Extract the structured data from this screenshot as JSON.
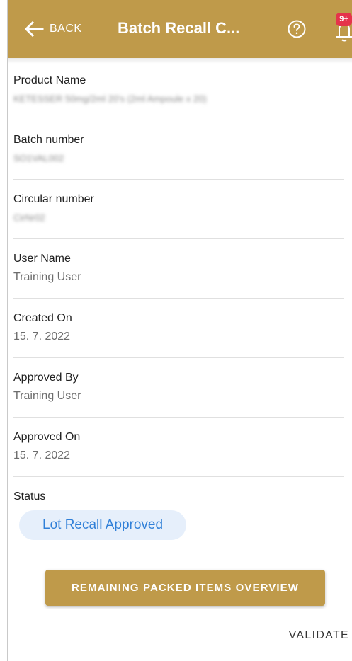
{
  "appbar": {
    "back_label": "BACK",
    "title": "Batch Recall C...",
    "badge": "9+",
    "color": "#bf9a4a"
  },
  "fields": [
    {
      "label": "Product Name",
      "value": "KETESSER 50mg/2ml 20's (2ml Ampoule x 20)"
    },
    {
      "label": "Batch number",
      "value": "SO1VAL002"
    },
    {
      "label": "Circular number",
      "value": "CirNr02"
    },
    {
      "label": "User Name",
      "value": "Training User"
    },
    {
      "label": "Created On",
      "value": "15. 7. 2022"
    },
    {
      "label": "Approved By",
      "value": "Training User"
    },
    {
      "label": "Approved On",
      "value": "15. 7. 2022"
    }
  ],
  "status": {
    "label": "Status",
    "value": "Lot Recall Approved"
  },
  "actions": {
    "remaining_button": "REMAINING PACKED ITEMS OVERVIEW",
    "validate_button": "VALIDATE"
  },
  "icons": {
    "back": "arrow-left-icon",
    "help": "help-circle-icon",
    "notifications": "bell-icon"
  }
}
